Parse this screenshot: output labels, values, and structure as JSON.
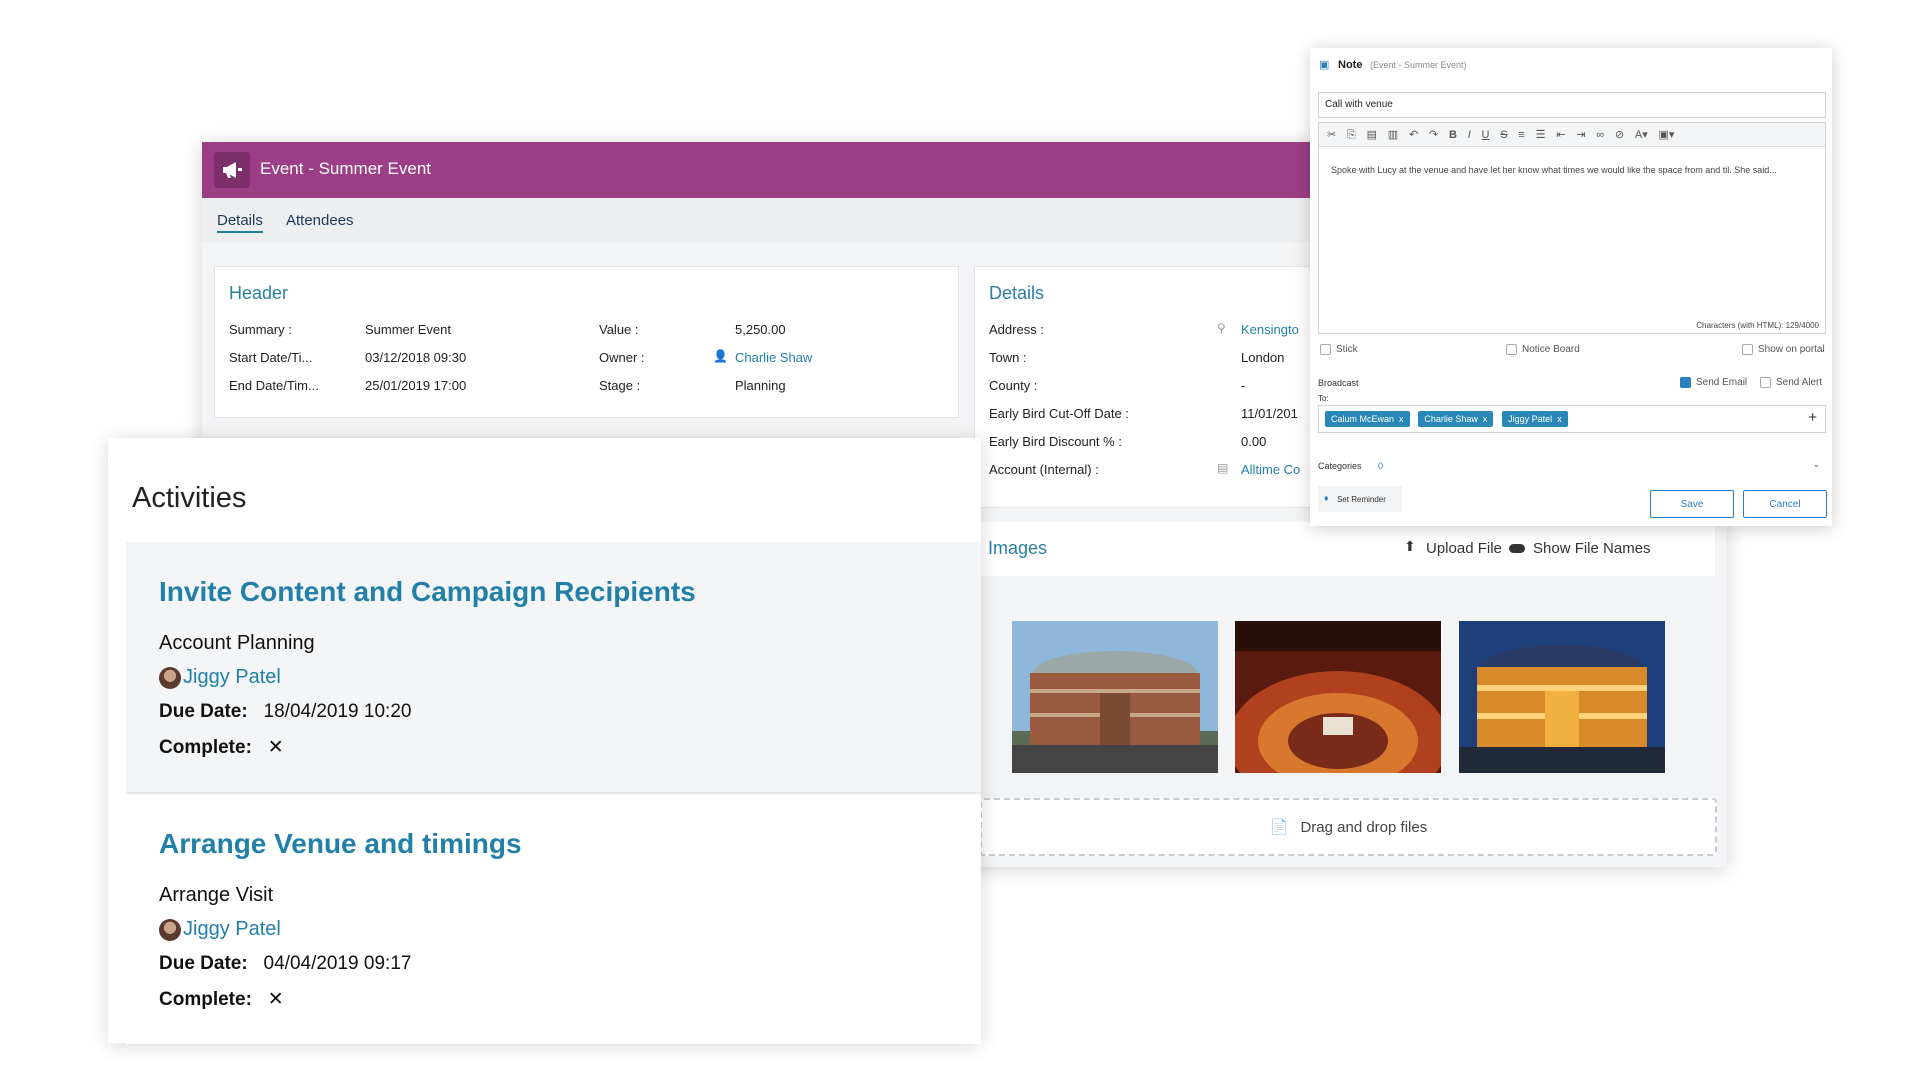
{
  "event": {
    "title": "Event - Summer Event",
    "tabs": [
      "Details",
      "Attendees"
    ],
    "header": {
      "title": "Header",
      "summary_label": "Summary :",
      "summary_value": "Summer Event",
      "start_label": "Start Date/Ti...",
      "start_value": "03/12/2018 09:30",
      "end_label": "End Date/Tim...",
      "end_value": "25/01/2019 17:00",
      "value_label": "Value :",
      "value_value": "5,250.00",
      "owner_label": "Owner :",
      "owner_value": "Charlie Shaw",
      "stage_label": "Stage :",
      "stage_value": "Planning"
    },
    "details": {
      "title": "Details",
      "address_label": "Address :",
      "address_value": "Kensingto",
      "town_label": "Town :",
      "town_value": "London",
      "county_label": "County :",
      "county_value": "-",
      "cutoff_label": "Early Bird Cut-Off Date :",
      "cutoff_value": "11/01/201",
      "discount_label": "Early Bird Discount % :",
      "discount_value": "0.00",
      "account_label": "Account (Internal) :",
      "account_value": "Alltime Co"
    },
    "images": {
      "title": "Images",
      "upload_label": "Upload File",
      "show_names_label": "Show File Names",
      "drop_label": "Drag and drop files"
    }
  },
  "activities": {
    "title": "Activities",
    "items": [
      {
        "title": "Invite Content and Campaign Recipients",
        "subtitle": "Account Planning",
        "user": "Jiggy Patel",
        "due_label": "Due Date:",
        "due_value": "18/04/2019 10:20",
        "complete_label": "Complete:",
        "complete_value": "✕"
      },
      {
        "title": "Arrange Venue and timings",
        "subtitle": "Arrange Visit",
        "user": "Jiggy Patel",
        "due_label": "Due Date:",
        "due_value": "04/04/2019 09:17",
        "complete_label": "Complete:",
        "complete_value": "✕"
      }
    ]
  },
  "note": {
    "title": "Note",
    "context": "(Event - Summer Event)",
    "subject": "Call with venue",
    "body": "Spoke with Lucy at the venue and have let her know what times we would like the space from and til. She said...",
    "char_count": "Characters (with HTML): 129/4000",
    "stick_label": "Stick",
    "notice_board_label": "Notice Board",
    "show_portal_label": "Show on portal",
    "broadcast_label": "Broadcast",
    "send_email_label": "Send Email",
    "send_alert_label": "Send Alert",
    "to_label": "To:",
    "recipients": [
      "Calum McEwan",
      "Charlie Shaw",
      "Jiggy Patel"
    ],
    "categories_label": "Categories",
    "categories_count": "0",
    "reminder_label": "Set Reminder",
    "save_label": "Save",
    "cancel_label": "Cancel",
    "send_email_checked": true
  }
}
